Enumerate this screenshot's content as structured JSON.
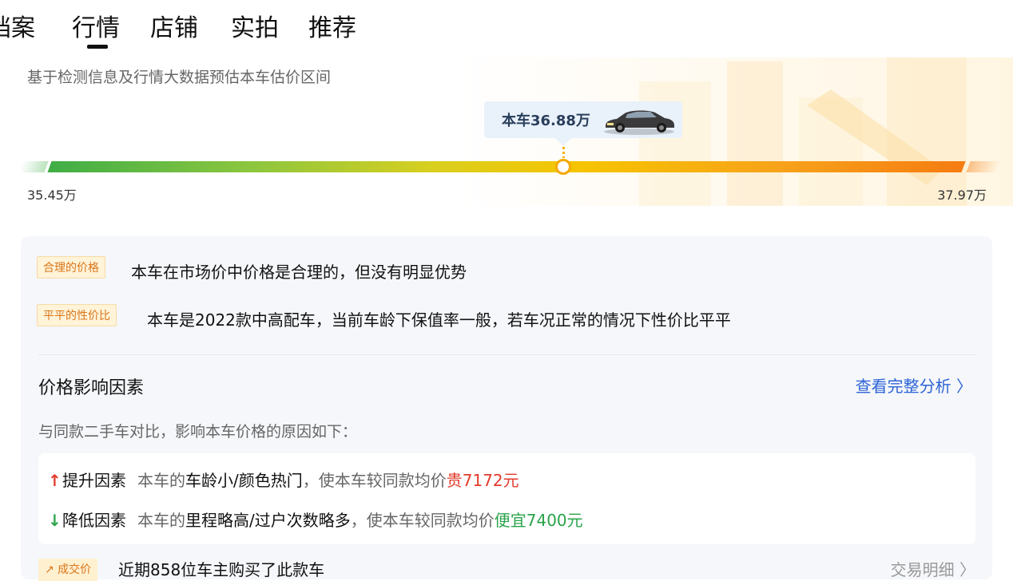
{
  "tabs": [
    "档案",
    "行情",
    "店铺",
    "实拍",
    "推荐"
  ],
  "active_tab": "行情",
  "hero": {
    "subtitle": "基于检测信息及行情大数据预估本车估价区间",
    "car_price": "本车36.88万",
    "range_min": "35.45万",
    "range_max": "37.97万"
  },
  "assessment": {
    "items": [
      {
        "tag": "合理的价格",
        "text": "本车在市场价中价格是合理的，但没有明显优势"
      },
      {
        "tag": "平平的性价比",
        "text": "本车是2022款中高配车，当前车龄下保值率一般，若车况正常的情况下性价比平平"
      }
    ]
  },
  "factors": {
    "title": "价格影响因素",
    "link": "查看完整分析 〉",
    "desc": "与同款二手车对比，影响本车价格的原因如下：",
    "rows": [
      {
        "arrow": "↑",
        "label": "提升因素",
        "prefix": "本车的",
        "reason": "车龄小/颜色热门",
        "middle": "，使本车较同款均价",
        "effect": "贵7172元"
      },
      {
        "arrow": "↓",
        "label": "降低因素",
        "prefix": "本车的",
        "reason": "里程略高/过户次数略多",
        "middle": "，使本车较同款均价",
        "effect": "便宜7400元"
      }
    ]
  },
  "bottom": {
    "tag": "↗ 成交价",
    "text": "近期858位车主购买了此款车",
    "link": "交易明细 〉"
  },
  "colors": {
    "accent_blue": "#2d63d6",
    "up_red": "#e4392b",
    "down_green": "#2aa34a",
    "tag_orange": "#d9761a"
  }
}
